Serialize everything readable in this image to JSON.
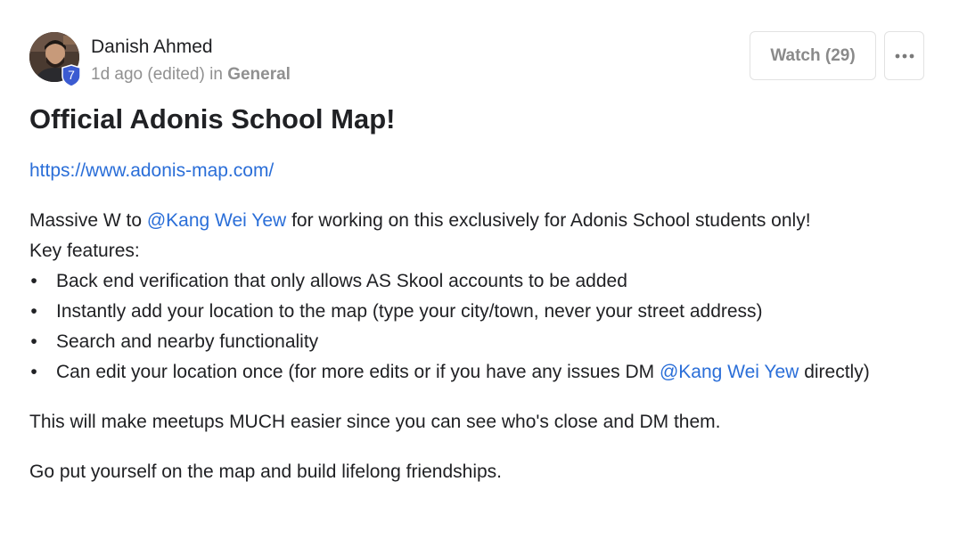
{
  "post": {
    "author": {
      "name": "Danish Ahmed",
      "level": "7"
    },
    "meta": {
      "time": "1d ago (edited)",
      "in_label": "in",
      "category": "General"
    },
    "actions": {
      "watch_label": "Watch (29)",
      "more_label": "•••"
    },
    "title": "Official Adonis School Map!",
    "link": "https://www.adonis-map.com/",
    "intro": {
      "prefix": "Massive W to ",
      "mention": "@Kang Wei Yew",
      "suffix": " for working on this exclusively for Adonis School students only!"
    },
    "features_heading": "Key features:",
    "features": [
      {
        "bullet": "•",
        "text": "Back end verification that only allows AS Skool accounts to be added"
      },
      {
        "bullet": "•",
        "text": "Instantly add your location to the map (type your city/town, never your street address)"
      },
      {
        "bullet": "•",
        "text": "Search and nearby functionality"
      },
      {
        "bullet": "•",
        "text": "Can edit your location once (for more edits or if you have any issues DM ",
        "mention": "@Kang Wei Yew",
        "suffix": " directly)"
      }
    ],
    "paragraph_2": "This will make meetups MUCH easier since you can see who's close and DM them.",
    "paragraph_3": "Go put yourself on the map and build lifelong friendships."
  },
  "colors": {
    "link": "#2a6ed8",
    "badge": "#3b5bd1",
    "meta_text": "#909090"
  },
  "icons": {
    "avatar": "user-avatar-photo",
    "level_badge": "shield-badge-icon",
    "more": "ellipsis-icon"
  }
}
